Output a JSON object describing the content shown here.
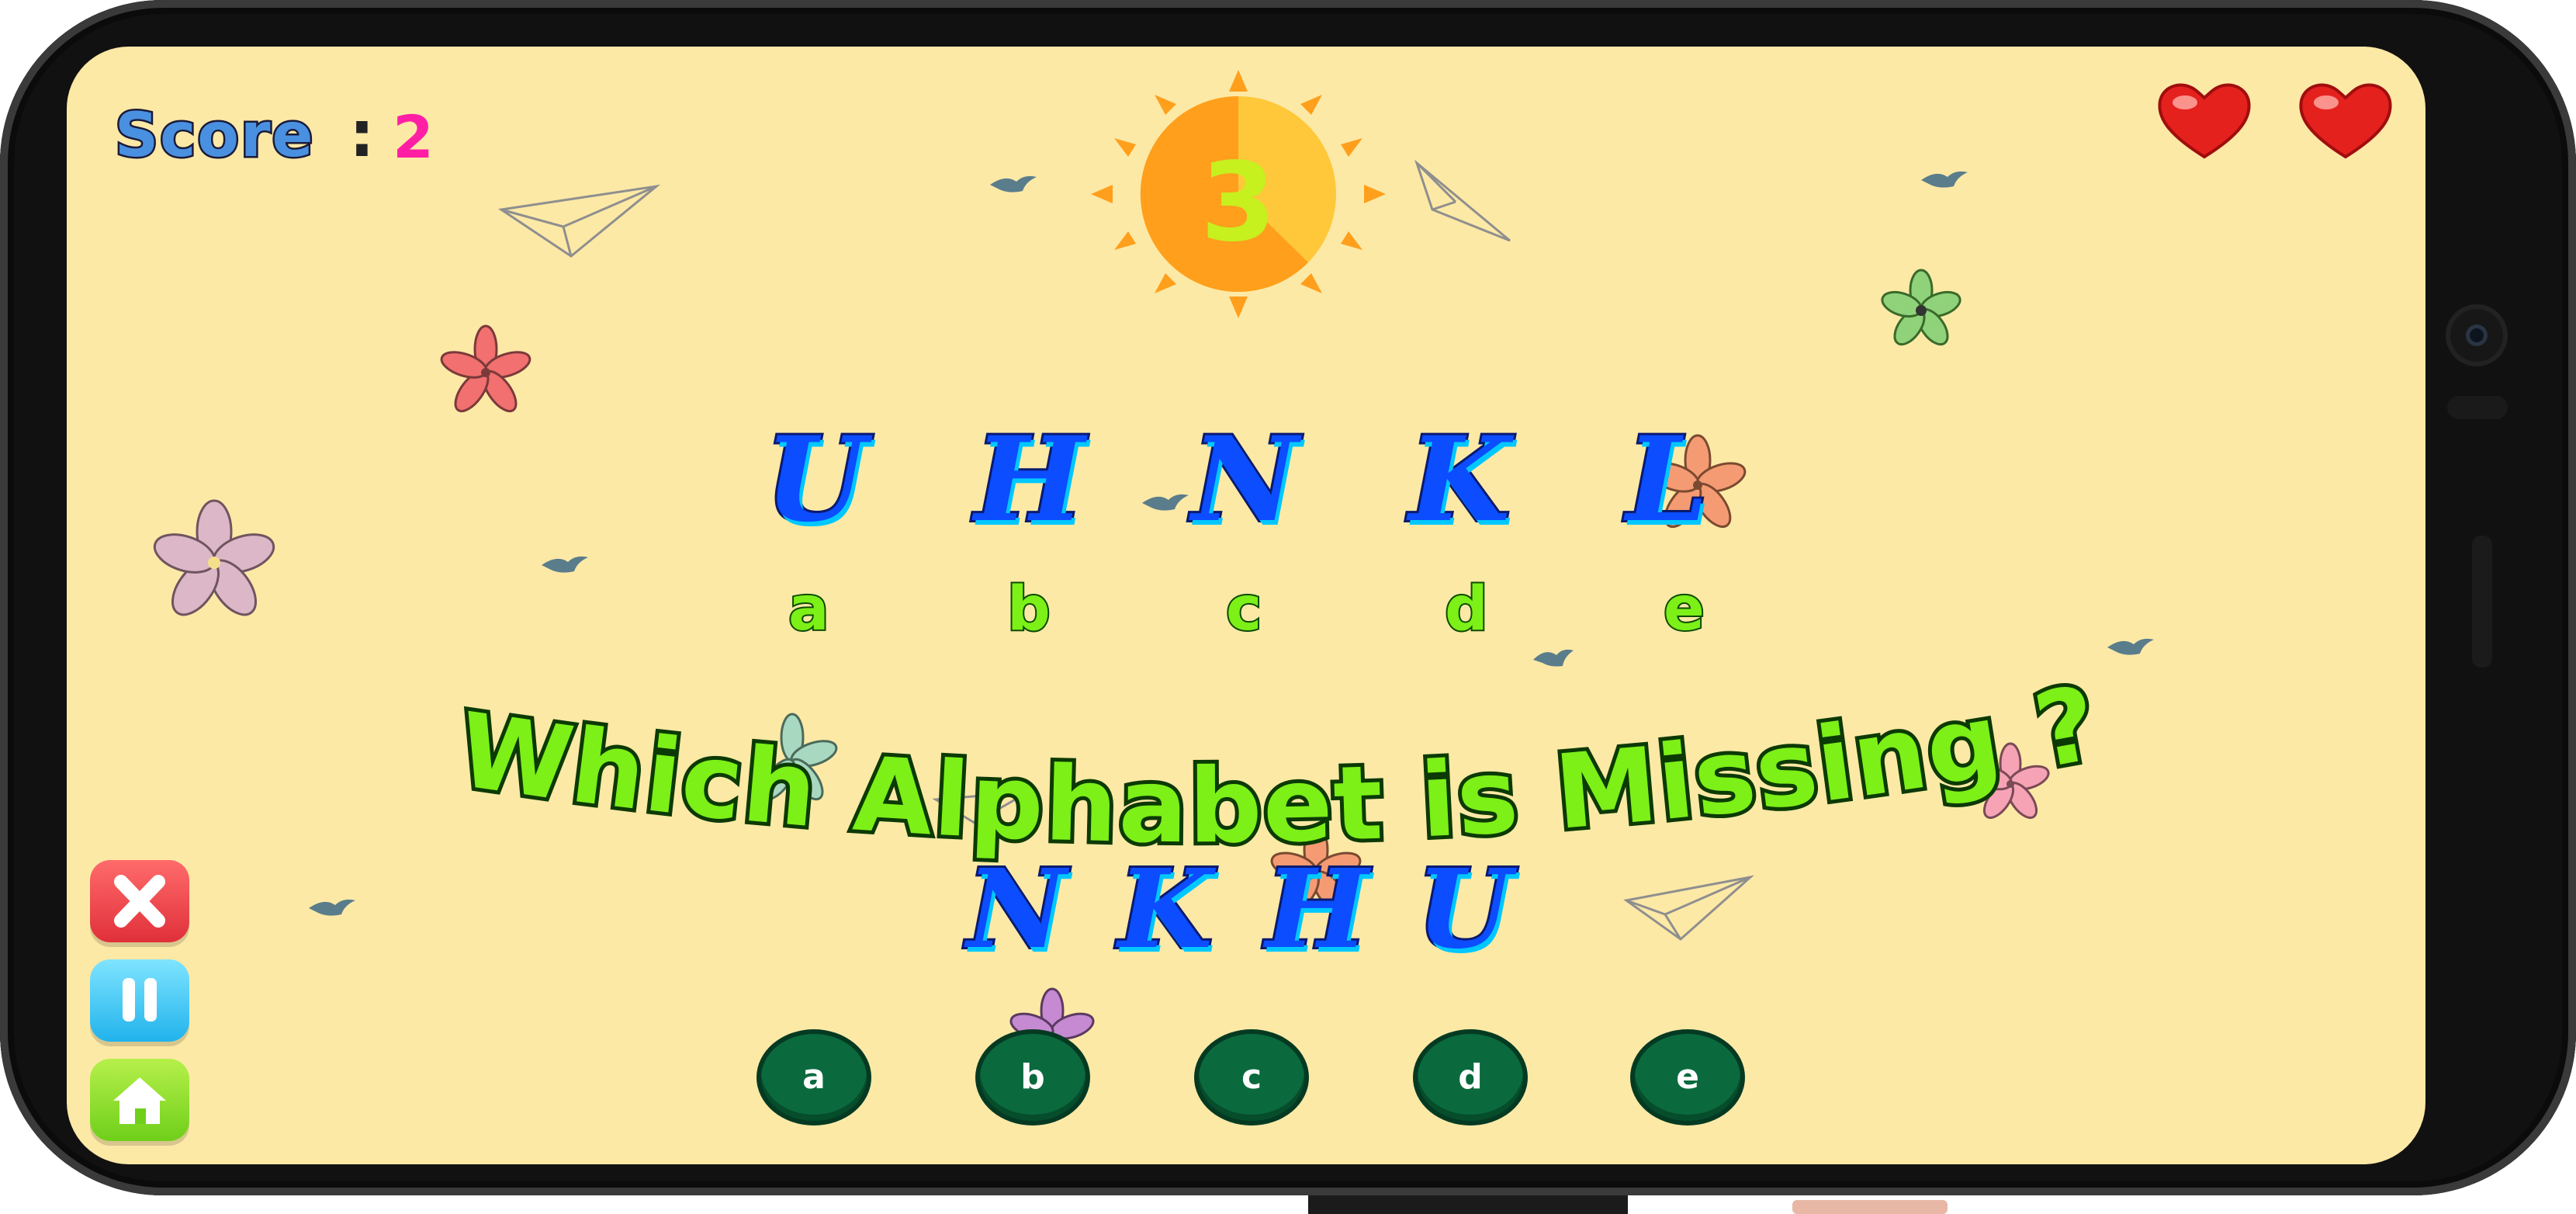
{
  "hud": {
    "score_label": "Score",
    "score_colon": ":",
    "score_value": "2",
    "timer_value": "3",
    "lives": 2
  },
  "sequence": {
    "letters": [
      "U",
      "H",
      "N",
      "K",
      "L"
    ],
    "position_labels": [
      "a",
      "b",
      "c",
      "d",
      "e"
    ]
  },
  "question": "Which Alphabet is Missing ?",
  "shown_letters": [
    "N",
    "K",
    "H",
    "U"
  ],
  "options": [
    "a",
    "b",
    "c",
    "d",
    "e"
  ],
  "side_buttons": {
    "close": "close-icon",
    "pause": "pause-icon",
    "home": "home-icon"
  },
  "colors": {
    "background": "#fde9a6",
    "letter_fill": "#0b4dff",
    "question_fill": "#7cf017",
    "option_button": "#0a6a3e",
    "score_value": "#ff1fa5",
    "sun": "#ff9f1c"
  }
}
